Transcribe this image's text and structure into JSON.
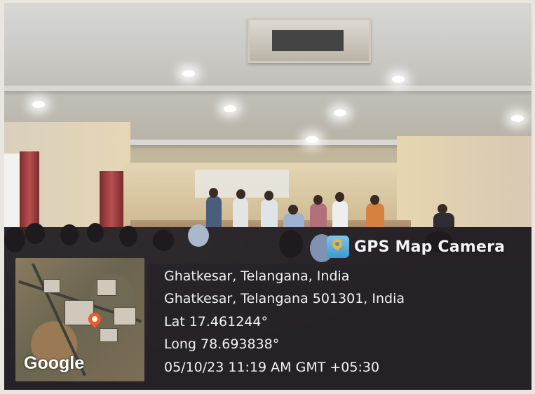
{
  "watermark": {
    "brand_label": "GPS Map Camera",
    "brand_icon": "map-pin-icon",
    "address_line1": "Ghatkesar, Telangana, India",
    "address_line2": "Ghatkesar, Telangana 501301, India",
    "latitude": "Lat 17.461244°",
    "longitude": "Long 78.693838°",
    "datetime": "05/10/23 11:19 AM GMT +05:30",
    "map_logo": "Google"
  },
  "colors": {
    "panel": "#262228",
    "text": "#f2f2f4",
    "pin": "#f25a1f",
    "brand_icon": "#3f97cf"
  }
}
